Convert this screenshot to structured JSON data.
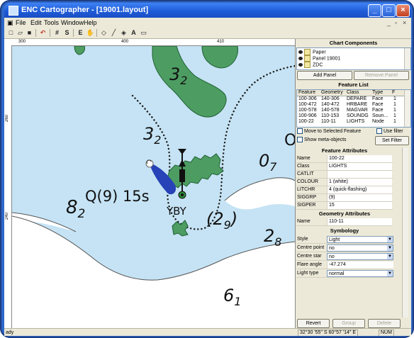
{
  "window": {
    "title": "ENC Cartographer - [19001.layout]",
    "min_icon": "minimize-icon",
    "max_icon": "maximize-icon",
    "close_icon": "close-icon"
  },
  "menu": [
    "File",
    "Edit",
    "Tools",
    "Window",
    "Help"
  ],
  "toolbar": {
    "icons": [
      "new-icon",
      "open-icon",
      "save-icon",
      "undo-icon",
      "grid-icon",
      "s-icon",
      "e-icon",
      "pan-icon",
      "select-icon",
      "line-icon",
      "area-icon",
      "text-tool-icon",
      "rect-icon"
    ],
    "glyphs": [
      "□",
      "▱",
      "■",
      "↶",
      "#",
      "S",
      "E",
      "✋",
      "◇",
      "╱",
      "◈",
      "A",
      "▭"
    ]
  },
  "rulers": {
    "top_ticks": [
      "300",
      "400",
      "410"
    ],
    "left_ticks": [
      "260",
      "240"
    ]
  },
  "map": {
    "depths": [
      {
        "value": "3",
        "sub": "2"
      },
      {
        "value": "3",
        "sub": "2"
      },
      {
        "value": "0",
        "sub": "7"
      },
      {
        "value": "8",
        "sub": "2"
      },
      {
        "value": "2",
        "sub": "9"
      },
      {
        "value": "2",
        "sub": "8"
      },
      {
        "value": "6",
        "sub": "1"
      }
    ],
    "light_label": "Q(9) 15s",
    "buoy_label": "YBY",
    "edge_letter": "O",
    "colors": {
      "shallow": "#c5e3f4",
      "deep": "#ffffff",
      "land": "#4d9d62",
      "land_edge": "#1f5f33",
      "light_flare": "#2743b7"
    }
  },
  "chart_components": {
    "title": "Chart Components",
    "items": [
      "Paper",
      "Panel 19001",
      "ZDC"
    ],
    "add_button": "Add Panel",
    "remove_button": "Remove Panel"
  },
  "feature_list": {
    "title": "Feature List",
    "columns": [
      "Feature",
      "Geometry",
      "Class",
      "Type",
      "F"
    ],
    "rows": [
      [
        "100-306",
        "140-306",
        "DEPARE",
        "Face",
        "1"
      ],
      [
        "100-472",
        "140-472",
        "HRBARE",
        "Face",
        "1"
      ],
      [
        "100-578",
        "140-578",
        "MAGVAR",
        "Face",
        "1"
      ],
      [
        "100-906",
        "110-153",
        "SOUNDG",
        "Soun...",
        "1"
      ],
      [
        "100-22",
        "110-11",
        "LIGHTS",
        "Node",
        "1"
      ]
    ],
    "move_label": "Move to Selected Feature",
    "use_filter_label": "Use filter",
    "show_meta_label": "Show meta-objects",
    "set_filter_button": "Set Filter"
  },
  "feature_attributes": {
    "title": "Feature Attributes",
    "rows": [
      {
        "name": "Name",
        "value": "100-22"
      },
      {
        "name": "Class",
        "value": "LIGHTS"
      },
      {
        "name": "CATLIT",
        "value": ""
      },
      {
        "name": "COLOUR",
        "value": "1 (white)"
      },
      {
        "name": "LITCHR",
        "value": "4 (quick-flashing)"
      },
      {
        "name": "SIGGRP",
        "value": "(9)"
      },
      {
        "name": "SIGPER",
        "value": "15"
      }
    ]
  },
  "geometry_attributes": {
    "title": "Geometry Attributes",
    "rows": [
      {
        "name": "Name",
        "value": "110-11"
      }
    ]
  },
  "symbology": {
    "title": "Symbology",
    "rows": [
      {
        "name": "Style",
        "value": "Light"
      },
      {
        "name": "Centre point",
        "value": "no"
      },
      {
        "name": "Centre star",
        "value": "no"
      },
      {
        "name": "Flare angle",
        "value": "-47.274"
      },
      {
        "name": "Light type",
        "value": "normal"
      }
    ],
    "buttons": [
      "Revert",
      "Group",
      "Delete"
    ]
  },
  "status": {
    "left": "ady",
    "coords": "32°30 '55\" S 60°57 '14\" E",
    "num": "NUM"
  }
}
